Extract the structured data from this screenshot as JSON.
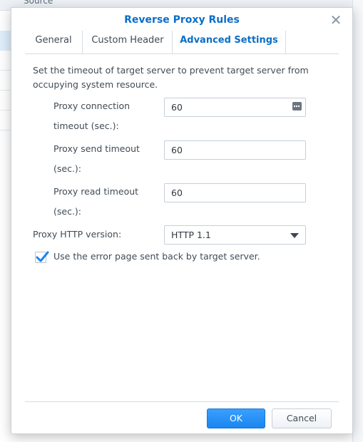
{
  "background": {
    "header_label": "Source"
  },
  "dialog": {
    "title": "Reverse Proxy Rules",
    "close_label": "✕"
  },
  "tabs": [
    {
      "label": "General",
      "active": false
    },
    {
      "label": "Custom Header",
      "active": false
    },
    {
      "label": "Advanced Settings",
      "active": true
    }
  ],
  "content": {
    "description": "Set the timeout of target server to prevent target server from occupying system resource.",
    "fields": [
      {
        "label_line1": "Proxy connection",
        "label_line2": "timeout (sec.):",
        "value": "60"
      },
      {
        "label_line1": "Proxy send timeout",
        "label_line2": "(sec.):",
        "value": "60"
      },
      {
        "label_line1": "Proxy read timeout",
        "label_line2": "(sec.):",
        "value": "60"
      }
    ],
    "http_version": {
      "label": "Proxy HTTP version:",
      "selected": "HTTP 1.1"
    },
    "error_page": {
      "label": "Use the error page sent back by target server.",
      "checked": true
    }
  },
  "footer": {
    "ok_label": "OK",
    "cancel_label": "Cancel"
  },
  "colors": {
    "accent": "#0b6ec7",
    "ok_button": "#1a86f0",
    "check": "#1a86f0"
  }
}
